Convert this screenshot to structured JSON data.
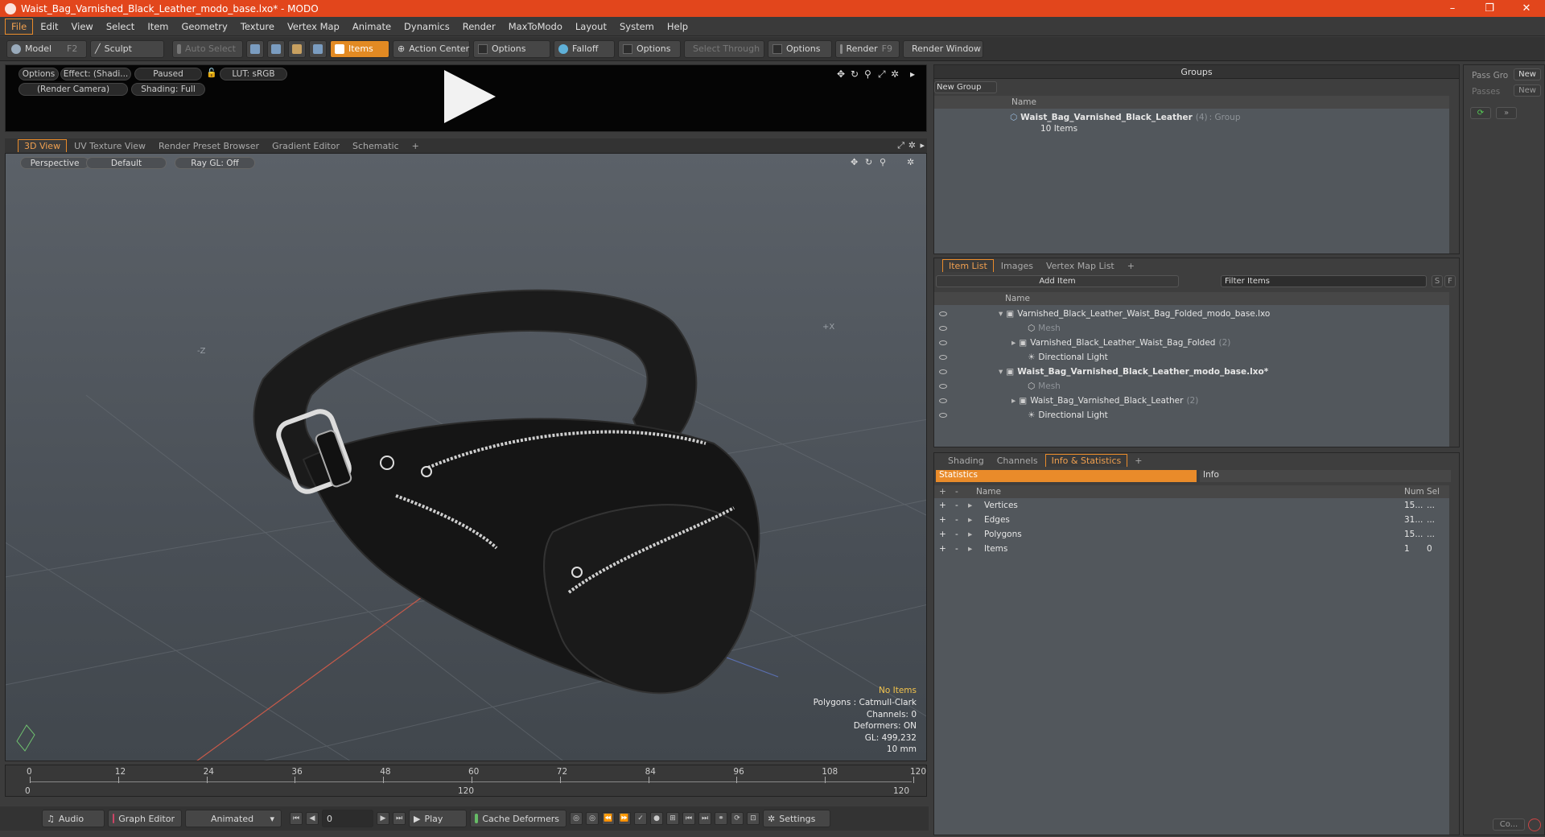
{
  "window": {
    "title": "Waist_Bag_Varnished_Black_Leather_modo_base.lxo* - MODO",
    "controls": [
      "–",
      "❐",
      "✕"
    ]
  },
  "menu": [
    "File",
    "Edit",
    "View",
    "Select",
    "Item",
    "Geometry",
    "Texture",
    "Vertex Map",
    "Animate",
    "Dynamics",
    "Render",
    "MaxToModo",
    "Layout",
    "System",
    "Help"
  ],
  "toolbar": {
    "model": "Model",
    "model_key": "F2",
    "sculpt": "Sculpt",
    "auto_select": "Auto Select",
    "items": "Items",
    "action_center": "Action Center",
    "options1": "Options",
    "falloff": "Falloff",
    "options2": "Options",
    "select_through": "Select Through",
    "options3": "Options",
    "render": "Render",
    "render_key": "F9",
    "render_window": "Render Window"
  },
  "preview": {
    "options": "Options",
    "effect": "Effect: (Shadi...",
    "paused": "Paused",
    "lut": "LUT: sRGB",
    "camera": "(Render Camera)",
    "shading": "Shading: Full"
  },
  "viewport_tabs": [
    "3D View",
    "UV Texture View",
    "Render Preset Browser",
    "Gradient Editor",
    "Schematic",
    "+"
  ],
  "viewport": {
    "view_mode": "Perspective",
    "style": "Default",
    "raygl": "Ray GL: Off",
    "axis_x": "+X",
    "axis_z": "-Z",
    "info": {
      "selection": "No Items",
      "polygons": "Polygons : Catmull-Clark",
      "channels": "Channels: 0",
      "deformers": "Deformers: ON",
      "gl": "GL: 499,232",
      "unit": "10 mm"
    }
  },
  "timeline": {
    "ticks": [
      "0",
      "12",
      "24",
      "36",
      "48",
      "60",
      "72",
      "84",
      "96",
      "108",
      "120"
    ],
    "range_start": "0",
    "range_mid": "120",
    "range_end": "120"
  },
  "bottombar": {
    "audio": "Audio",
    "graph_editor": "Graph Editor",
    "animated": "Animated",
    "frame": "0",
    "play": "Play",
    "cache_deformers": "Cache Deformers",
    "settings": "Settings"
  },
  "groups": {
    "title": "Groups",
    "new_group": "New Group",
    "col_name": "Name",
    "item_name": "Waist_Bag_Varnished_Black_Leather",
    "item_count": "(4)",
    "item_type": ": Group",
    "item_sub": "10 Items"
  },
  "pass_panel": {
    "pass_group": "Pass Gro",
    "passes": "Passes",
    "new1": "New",
    "new2": "New",
    "co": "Co..."
  },
  "item_list": {
    "tabs": [
      "Item List",
      "Images",
      "Vertex Map List",
      "+"
    ],
    "add_item": "Add Item",
    "filter": "Filter Items",
    "s": "S",
    "f": "F",
    "col_name": "Name",
    "rows": [
      {
        "label": "Varnished_Black_Leather_Waist_Bag_Folded_modo_base.lxo",
        "indent": 0,
        "bold": false
      },
      {
        "label": "Mesh",
        "indent": 2,
        "bold": false,
        "dim": true
      },
      {
        "label": "Varnished_Black_Leather_Waist_Bag_Folded",
        "suffix": "(2)",
        "indent": 1,
        "bold": false
      },
      {
        "label": "Directional Light",
        "indent": 2,
        "bold": false
      },
      {
        "label": "Waist_Bag_Varnished_Black_Leather_modo_base.lxo*",
        "indent": 0,
        "bold": true
      },
      {
        "label": "Mesh",
        "indent": 2,
        "bold": false,
        "dim": true
      },
      {
        "label": "Waist_Bag_Varnished_Black_Leather",
        "suffix": "(2)",
        "indent": 1,
        "bold": false
      },
      {
        "label": "Directional Light",
        "indent": 2,
        "bold": false
      }
    ]
  },
  "stats": {
    "tabs": [
      "Shading",
      "Channels",
      "Info & Statistics",
      "+"
    ],
    "statistics": "Statistics",
    "info": "Info",
    "col_name": "Name",
    "col_num": "Num",
    "col_sel": "Sel",
    "rows": [
      {
        "name": "Vertices",
        "num": "15...",
        "sel": "..."
      },
      {
        "name": "Edges",
        "num": "31...",
        "sel": "..."
      },
      {
        "name": "Polygons",
        "num": "15...",
        "sel": "..."
      },
      {
        "name": "Items",
        "num": "1",
        "sel": "0"
      }
    ]
  },
  "colors": {
    "accent": "#e98b2a",
    "titlebar": "#e2461c"
  }
}
